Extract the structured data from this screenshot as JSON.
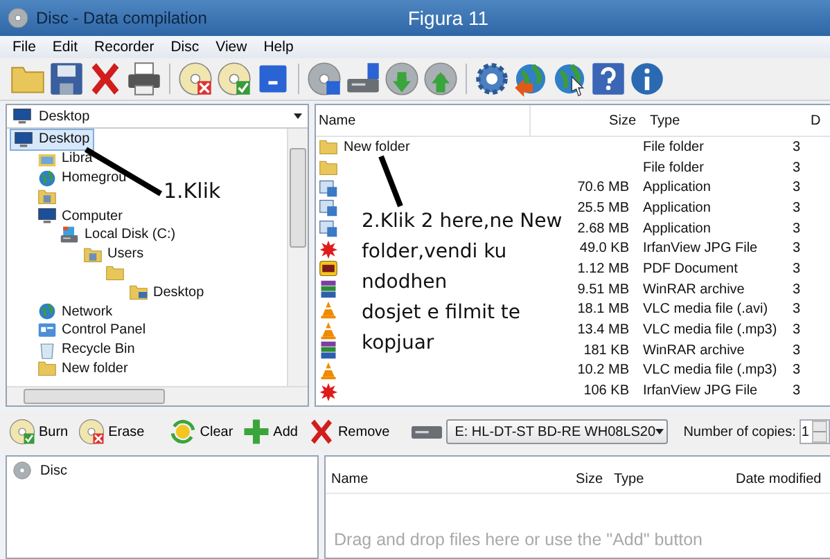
{
  "window": {
    "title": "Disc - Data compilation",
    "annotation_title": "Figura 11"
  },
  "menu": [
    "File",
    "Edit",
    "Recorder",
    "Disc",
    "View",
    "Help"
  ],
  "toolbar": [
    [
      {
        "kind": "folder"
      },
      {
        "kind": "floppy"
      },
      {
        "kind": "delete"
      },
      {
        "kind": "printer"
      }
    ],
    [
      {
        "kind": "disc-x"
      },
      {
        "kind": "disc-check"
      },
      {
        "kind": "square"
      }
    ],
    [
      {
        "kind": "disc-info"
      },
      {
        "kind": "drive-info"
      },
      {
        "kind": "disc-down"
      },
      {
        "kind": "disc-up"
      }
    ],
    [
      {
        "kind": "gear"
      },
      {
        "kind": "globe-arrow"
      },
      {
        "kind": "globe-cursor"
      },
      {
        "kind": "help"
      },
      {
        "kind": "info"
      }
    ]
  ],
  "location": {
    "value": "Desktop"
  },
  "tree": [
    {
      "label": "Desktop",
      "kind": "monitor",
      "selected": true,
      "children": [
        {
          "label": "Libra",
          "kind": "libraries",
          "selected": false
        },
        {
          "label": "Homegrou",
          "kind": "homegroup",
          "selected": false
        },
        {
          "kind": "user-folder",
          "selected": false
        },
        {
          "label": "Computer",
          "kind": "computer",
          "selected": false,
          "children": [
            {
              "label": "Local Disk (C:)",
              "kind": "drive",
              "selected": false,
              "children": [
                {
                  "label": "Users",
                  "kind": "user-folder",
                  "selected": false,
                  "children": [
                    {
                      "kind": "folder",
                      "selected": false,
                      "children": [
                        {
                          "label": "Desktop",
                          "kind": "desktop-folder",
                          "selected": false
                        }
                      ]
                    }
                  ]
                }
              ]
            }
          ]
        },
        {
          "label": "Network",
          "kind": "network",
          "selected": false
        },
        {
          "label": "Control Panel",
          "kind": "control-panel",
          "selected": false
        },
        {
          "label": "Recycle Bin",
          "kind": "recycle",
          "selected": false
        },
        {
          "label": "New folder",
          "kind": "folder",
          "selected": false
        }
      ]
    }
  ],
  "files": {
    "columns": [
      "Name",
      "Size",
      "Type",
      "D"
    ],
    "rows": [
      {
        "kind": "folder",
        "name": "New folder",
        "type": "File folder",
        "date": "3"
      },
      {
        "kind": "folder",
        "type": "File folder",
        "date": "3"
      },
      {
        "kind": "app",
        "size": "70.6 MB",
        "type": "Application",
        "date": "3"
      },
      {
        "kind": "app",
        "size": "25.5 MB",
        "type": "Application",
        "date": "3"
      },
      {
        "kind": "app",
        "size": "2.68 MB",
        "type": "Application",
        "date": "3"
      },
      {
        "kind": "image",
        "size": "49.0 KB",
        "type": "IrfanView JPG File",
        "date": "3"
      },
      {
        "kind": "pdf",
        "size": "1.12 MB",
        "type": "PDF Document",
        "date": "3"
      },
      {
        "kind": "archive",
        "size": "9.51 MB",
        "type": "WinRAR archive",
        "date": "3"
      },
      {
        "kind": "cone",
        "size": "18.1 MB",
        "type": "VLC media file (.avi)",
        "date": "3"
      },
      {
        "kind": "cone",
        "size": "13.4 MB",
        "type": "VLC media file (.mp3)",
        "date": "3"
      },
      {
        "kind": "archive",
        "size": "181 KB",
        "type": "WinRAR archive",
        "date": "3"
      },
      {
        "kind": "cone",
        "size": "10.2 MB",
        "type": "VLC media file (.mp3)",
        "date": "3"
      },
      {
        "kind": "image",
        "size": "106 KB",
        "type": "IrfanView JPG File",
        "date": "3"
      }
    ]
  },
  "annotations": [
    "1.Klik",
    "2.Klik 2 here,ne New\nfolder,vendi ku\nndodhen\ndosjet e filmit te\nkopjuar"
  ],
  "burn_toolbar": {
    "buttons": [
      {
        "kind": "disc-check",
        "label": "Burn"
      },
      {
        "kind": "disc-x",
        "label": "Erase"
      },
      {
        "kind": "refresh",
        "label": "Clear"
      },
      {
        "kind": "plus",
        "label": "Add"
      },
      {
        "kind": "delete",
        "label": "Remove"
      }
    ],
    "drive": "E: HL-DT-ST BD-RE  WH08LS20",
    "copies_label": "Number of copies:",
    "copies": "1"
  },
  "compilation": {
    "tree": [
      {
        "label": "Disc",
        "kind": "disc"
      }
    ],
    "columns": [
      "Name",
      "Size",
      "Type",
      "Date modified"
    ],
    "empty_text": "Drag and drop files here or use the \"Add\" button"
  }
}
